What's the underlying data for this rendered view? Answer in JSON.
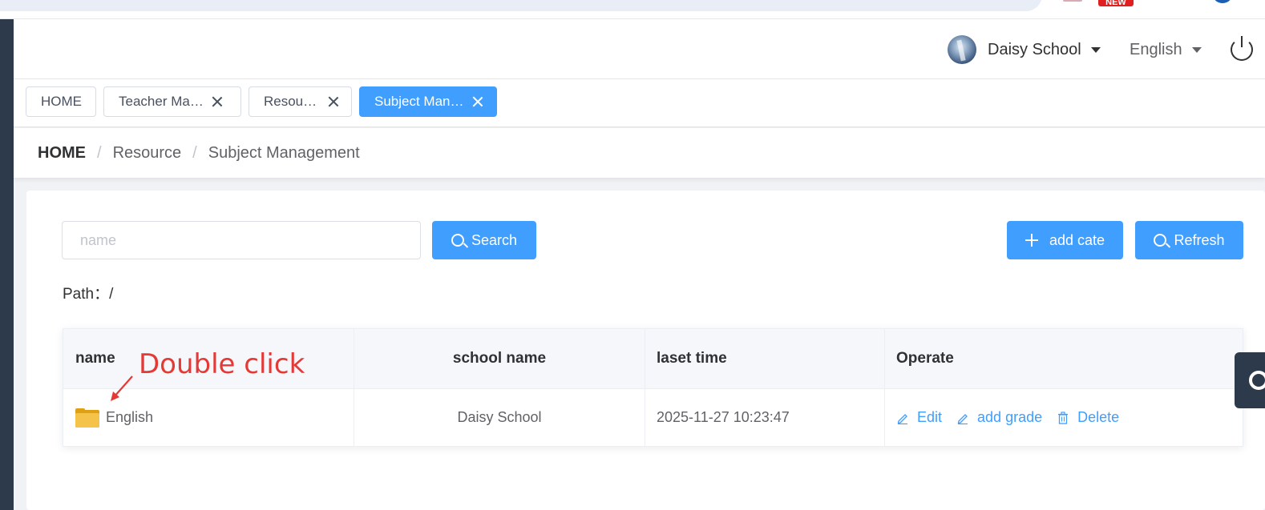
{
  "browser": {
    "new_badge": "NEW"
  },
  "header": {
    "user_name": "Daisy School",
    "language": "English"
  },
  "tags": [
    {
      "label": "HOME",
      "closable": false,
      "active": false
    },
    {
      "label": "Teacher Ma…",
      "closable": true,
      "active": false
    },
    {
      "label": "Resource",
      "closable": true,
      "active": false
    },
    {
      "label": "Subject Man…",
      "closable": true,
      "active": true
    }
  ],
  "breadcrumb": {
    "items": [
      "HOME",
      "Resource",
      "Subject Management"
    ],
    "separator": "/"
  },
  "toolbar": {
    "search_placeholder": "name",
    "search_value": "",
    "search_label": "Search",
    "add_label": "add cate",
    "refresh_label": "Refresh"
  },
  "path": {
    "label": "Path：",
    "value": "/"
  },
  "table": {
    "columns": [
      "name",
      "school name",
      "laset time",
      "Operate"
    ],
    "rows": [
      {
        "name": "English",
        "school_name": "Daisy School",
        "time": "2025-11-27 10:23:47",
        "operations": [
          "Edit",
          "add grade",
          "Delete"
        ]
      }
    ]
  },
  "annotation": {
    "text": "Double click",
    "color": "#e53935"
  },
  "colors": {
    "primary": "#409eff",
    "sidebar": "#2d3a4b",
    "folder": "#f6c34a"
  }
}
